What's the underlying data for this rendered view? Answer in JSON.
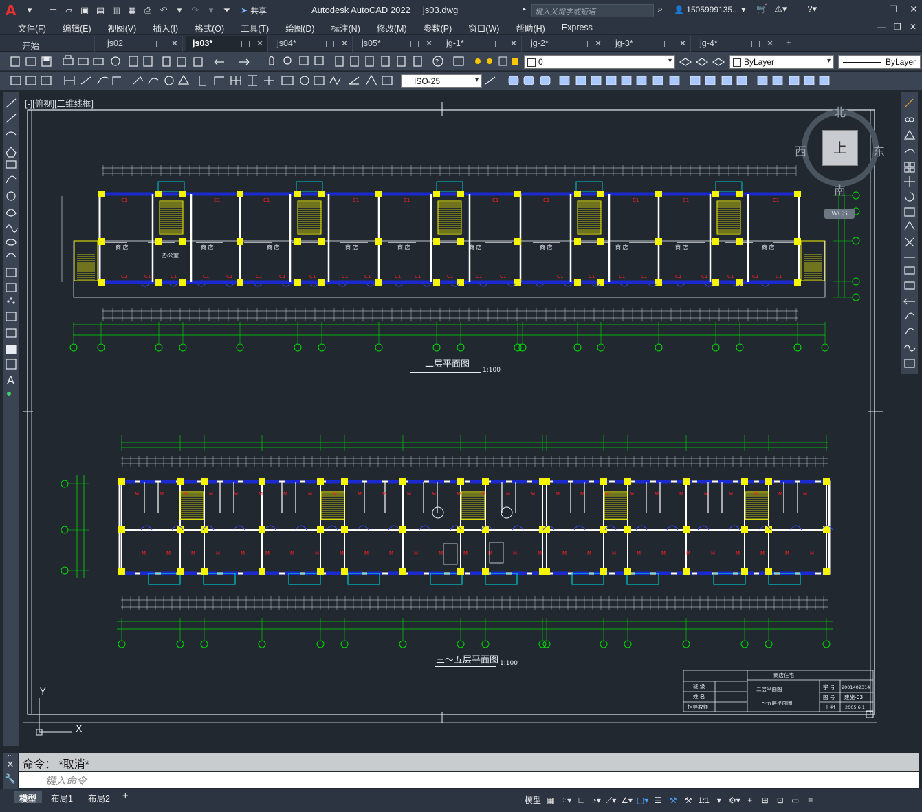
{
  "titlebar": {
    "app_title": "Autodesk AutoCAD 2022",
    "file_name": "js03.dwg",
    "share_label": "共享",
    "search_placeholder": "键入关键字或短语",
    "user_name": "1505999135..."
  },
  "menu": {
    "items": [
      "文件(F)",
      "编辑(E)",
      "视图(V)",
      "插入(I)",
      "格式(O)",
      "工具(T)",
      "绘图(D)",
      "标注(N)",
      "修改(M)",
      "参数(P)",
      "窗口(W)",
      "帮助(H)",
      "Express"
    ]
  },
  "tabs": [
    {
      "label": "开始",
      "active": false
    },
    {
      "label": "js02",
      "active": false
    },
    {
      "label": "js03*",
      "active": true
    },
    {
      "label": "js04*",
      "active": false
    },
    {
      "label": "js05*",
      "active": false
    },
    {
      "label": "jg-1*",
      "active": false
    },
    {
      "label": "jg-2*",
      "active": false
    },
    {
      "label": "jg-3*",
      "active": false
    },
    {
      "label": "jg-4*",
      "active": false
    }
  ],
  "toolbar": {
    "layer_value": "0",
    "color_value": "ByLayer",
    "linetype_value": "ByLayer",
    "dimstyle_value": "ISO-25"
  },
  "viewport": {
    "label": "[-][俯视][二维线框]"
  },
  "viewcube": {
    "north": "北",
    "south": "南",
    "east": "东",
    "west": "西",
    "top": "上",
    "wcs": "WCS"
  },
  "drawing": {
    "plan1_title": "二层平面图",
    "plan1_scale": "1:100",
    "plan2_title": "三～五层平面图",
    "plan2_scale": "1:100",
    "room_label": "商 店",
    "office_label": "办公室",
    "axis_labels": [
      "1",
      "2",
      "3",
      "4",
      "5",
      "6",
      "7",
      "8",
      "9",
      "10",
      "11",
      "12",
      "13",
      "14",
      "15",
      "16",
      "17"
    ],
    "row_labels": [
      "C",
      "B",
      "A"
    ],
    "titleblock": {
      "project": "商店住宅",
      "class_label": "班 级",
      "name_label": "姓 名",
      "teacher_label": "指导教师",
      "drawing1": "二层平面图",
      "drawing2": "三～五层平面图",
      "student_no_label": "学 号",
      "student_no": "2001402314",
      "drawing_no_label": "图 号",
      "drawing_no": "建施-03",
      "date_label": "日 期",
      "date": "2005.6.1"
    }
  },
  "command": {
    "history": "命令： *取消*",
    "input_placeholder": "键入命令"
  },
  "status": {
    "layouts": [
      {
        "label": "模型",
        "active": true
      },
      {
        "label": "布局1",
        "active": false
      },
      {
        "label": "布局2",
        "active": false
      }
    ],
    "model_label": "模型",
    "scale_label": "1:1"
  },
  "colors": {
    "wall": "#ffffff",
    "column": "#f5f500",
    "window": "#1a2ad0",
    "door": "#3a4cff",
    "dimension": "#00e000",
    "text_red": "#ff2020",
    "stair": "#f5f500",
    "balcony": "#00c8d0"
  }
}
